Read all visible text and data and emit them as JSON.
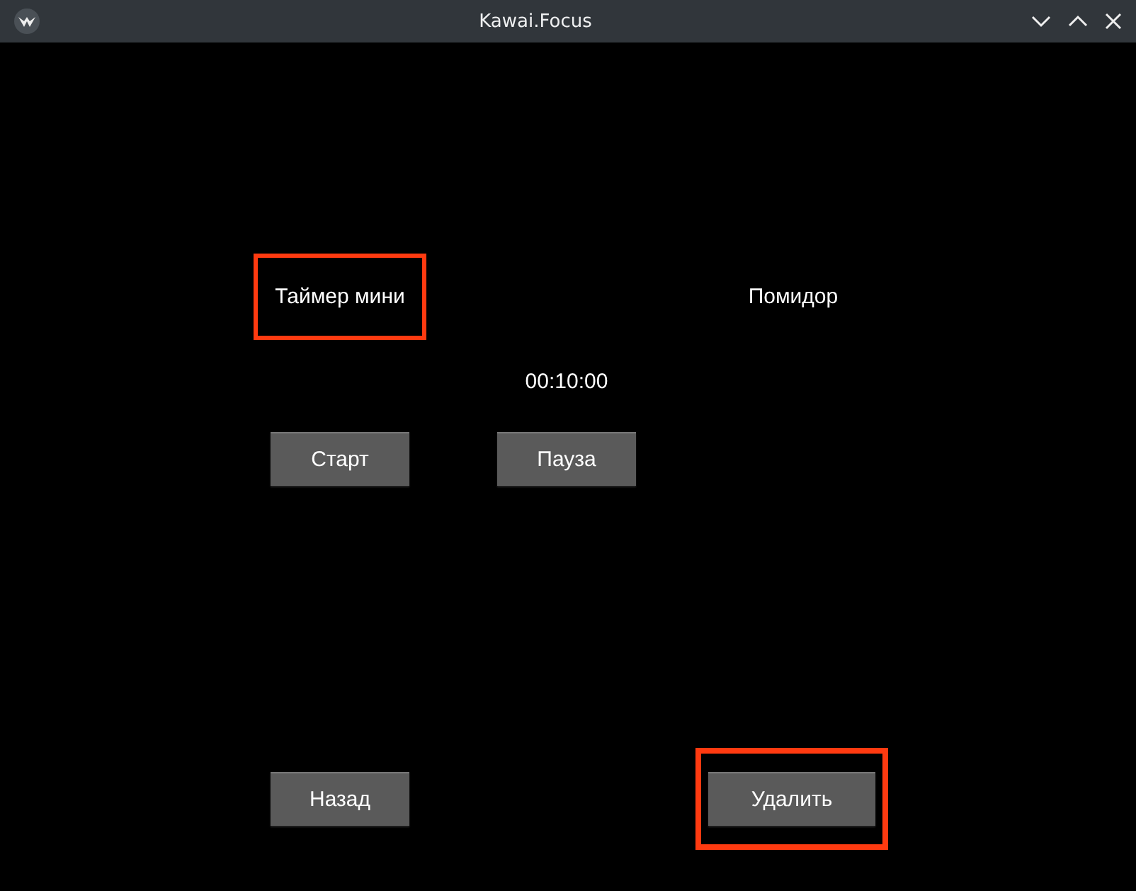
{
  "window": {
    "title": "Kawai.Focus"
  },
  "labels": [
    {
      "text": "Таймер мини",
      "highlighted": true
    },
    {
      "text": "Помидор",
      "highlighted": false
    }
  ],
  "time": "00:10:00",
  "timer_buttons": [
    {
      "label": "Старт",
      "highlighted": false
    },
    {
      "label": "Пауза",
      "highlighted": false
    }
  ],
  "bottom_buttons": [
    {
      "label": "Назад",
      "highlighted": false
    },
    {
      "label": "Удалить",
      "highlighted": true
    }
  ]
}
